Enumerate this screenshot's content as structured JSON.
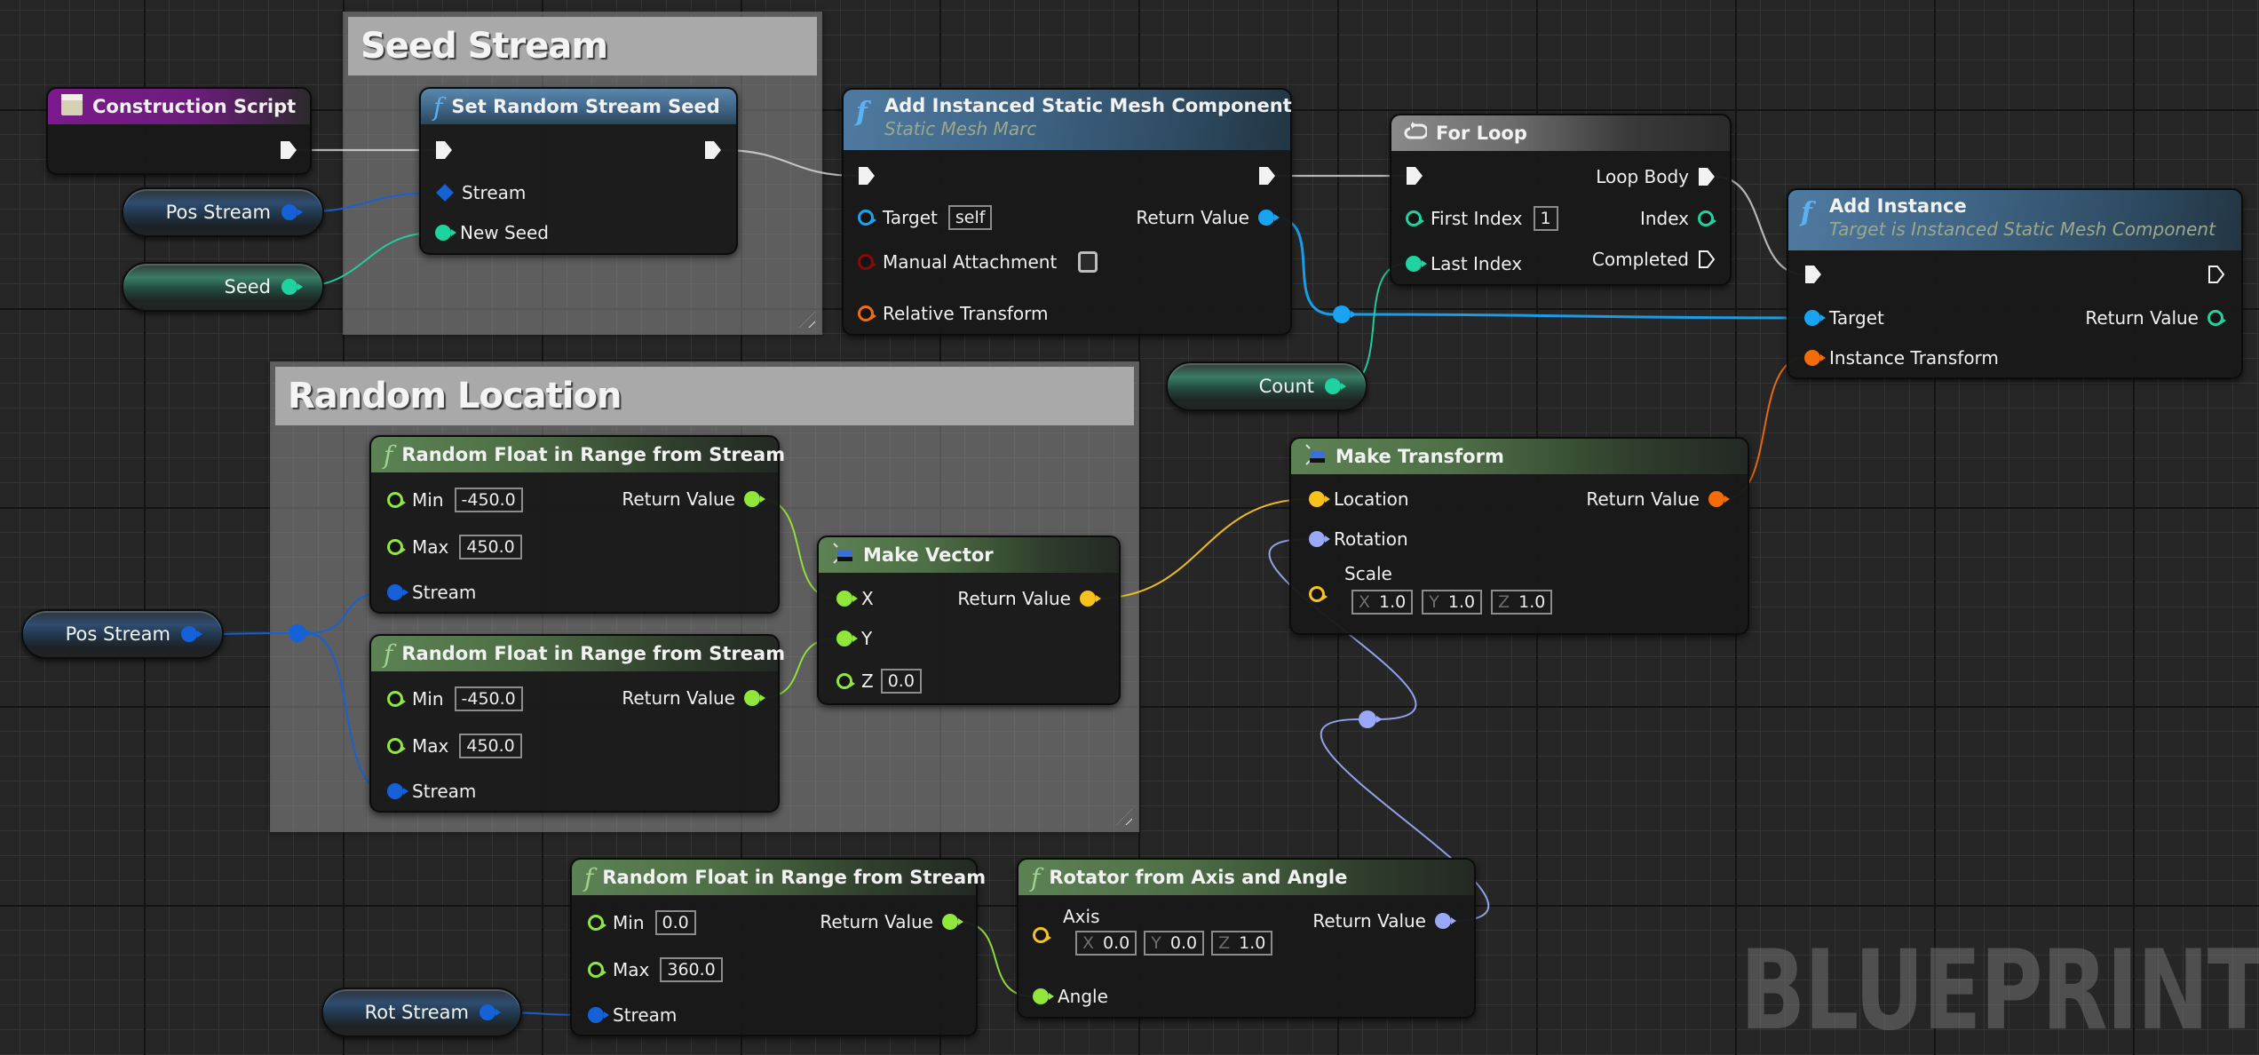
{
  "watermark": "BLUEPRINT",
  "colors": {
    "exec": "#e6e6e6",
    "stream": "#1561d8",
    "int": "#1fd3a0",
    "object": "#18a3f3",
    "bool": "#8c0808",
    "transform": "#f26d0a",
    "float": "#90e63a",
    "vector": "#f8c21c",
    "rotator": "#9aa9f7"
  },
  "comments": {
    "seed_stream": "Seed Stream",
    "random_location": "Random Location"
  },
  "variables": {
    "pos_stream_1": "Pos Stream",
    "seed": "Seed",
    "pos_stream_2": "Pos Stream",
    "count": "Count",
    "rot_stream": "Rot Stream"
  },
  "nodes": {
    "construction_script": {
      "title": "Construction Script"
    },
    "set_random_stream_seed": {
      "title": "Set Random Stream Seed",
      "pins": {
        "stream": "Stream",
        "new_seed": "New Seed"
      }
    },
    "add_ismc": {
      "title": "Add Instanced Static Mesh Component",
      "subtitle": "Static Mesh Marc",
      "pins": {
        "target": "Target",
        "target_value": "self",
        "manual_attachment": "Manual Attachment",
        "manual_attachment_checked": false,
        "relative_transform": "Relative Transform",
        "return_value": "Return Value"
      }
    },
    "for_loop": {
      "title": "For Loop",
      "pins": {
        "first_index": "First Index",
        "first_index_value": "1",
        "last_index": "Last Index",
        "loop_body": "Loop Body",
        "index": "Index",
        "completed": "Completed"
      }
    },
    "add_instance": {
      "title": "Add Instance",
      "subtitle": "Target is Instanced Static Mesh Component",
      "pins": {
        "target": "Target",
        "instance_transform": "Instance Transform",
        "return_value": "Return Value"
      }
    },
    "random_float_x": {
      "title": "Random Float in Range from Stream",
      "pins": {
        "min": "Min",
        "min_value": "-450.0",
        "max": "Max",
        "max_value": "450.0",
        "stream": "Stream",
        "return_value": "Return Value"
      }
    },
    "random_float_y": {
      "title": "Random Float in Range from Stream",
      "pins": {
        "min": "Min",
        "min_value": "-450.0",
        "max": "Max",
        "max_value": "450.0",
        "stream": "Stream",
        "return_value": "Return Value"
      }
    },
    "make_vector": {
      "title": "Make Vector",
      "pins": {
        "x": "X",
        "y": "Y",
        "z": "Z",
        "z_value": "0.0",
        "return_value": "Return Value"
      }
    },
    "make_transform": {
      "title": "Make Transform",
      "pins": {
        "location": "Location",
        "rotation": "Rotation",
        "scale": "Scale",
        "scale_x_label": "X",
        "scale_x": "1.0",
        "scale_y_label": "Y",
        "scale_y": "1.0",
        "scale_z_label": "Z",
        "scale_z": "1.0",
        "return_value": "Return Value"
      }
    },
    "random_float_rot": {
      "title": "Random Float in Range from Stream",
      "pins": {
        "min": "Min",
        "min_value": "0.0",
        "max": "Max",
        "max_value": "360.0",
        "stream": "Stream",
        "return_value": "Return Value"
      }
    },
    "rotator_from_axis": {
      "title": "Rotator from Axis and Angle",
      "pins": {
        "axis": "Axis",
        "axis_x_label": "X",
        "axis_x": "0.0",
        "axis_y_label": "Y",
        "axis_y": "0.0",
        "axis_z_label": "Z",
        "axis_z": "1.0",
        "angle": "Angle",
        "return_value": "Return Value"
      }
    }
  },
  "connections": [
    {
      "from": "cs-exec-out",
      "to": "srs-exec-in",
      "type": "exec"
    },
    {
      "from": "srs-exec-out",
      "to": "aismc-exec-in",
      "type": "exec"
    },
    {
      "from": "aismc-exec-out",
      "to": "fl-exec-in",
      "type": "exec"
    },
    {
      "from": "fl-loop-body",
      "to": "ai-exec-in",
      "type": "exec"
    },
    {
      "from": "var-pos1",
      "to": "srs-stream",
      "type": "stream"
    },
    {
      "from": "var-seed",
      "to": "srs-newseed",
      "type": "int"
    },
    {
      "from": "aismc-ret",
      "to": "knot-obj",
      "type": "object"
    },
    {
      "from": "knot-obj",
      "to": "ai-target",
      "type": "object"
    },
    {
      "from": "var-count",
      "to": "fl-last",
      "type": "int"
    },
    {
      "from": "var-pos2",
      "to": "knot-stream",
      "type": "stream"
    },
    {
      "from": "knot-stream",
      "to": "rfx-stream",
      "type": "stream"
    },
    {
      "from": "knot-stream",
      "to": "rfy-stream",
      "type": "stream"
    },
    {
      "from": "rfx-ret",
      "to": "mv-x",
      "type": "float"
    },
    {
      "from": "rfy-ret",
      "to": "mv-y",
      "type": "float"
    },
    {
      "from": "mv-ret",
      "to": "mt-loc",
      "type": "vector"
    },
    {
      "from": "mt-ret",
      "to": "ai-transform",
      "type": "transform"
    },
    {
      "from": "var-rot",
      "to": "rfr-stream",
      "type": "stream"
    },
    {
      "from": "rfr-ret",
      "to": "rot-angle",
      "type": "float"
    },
    {
      "from": "rot-ret",
      "to": "knot-rot",
      "type": "rotator"
    },
    {
      "from": "knot-rot",
      "to": "mt-rot",
      "type": "rotator"
    }
  ]
}
